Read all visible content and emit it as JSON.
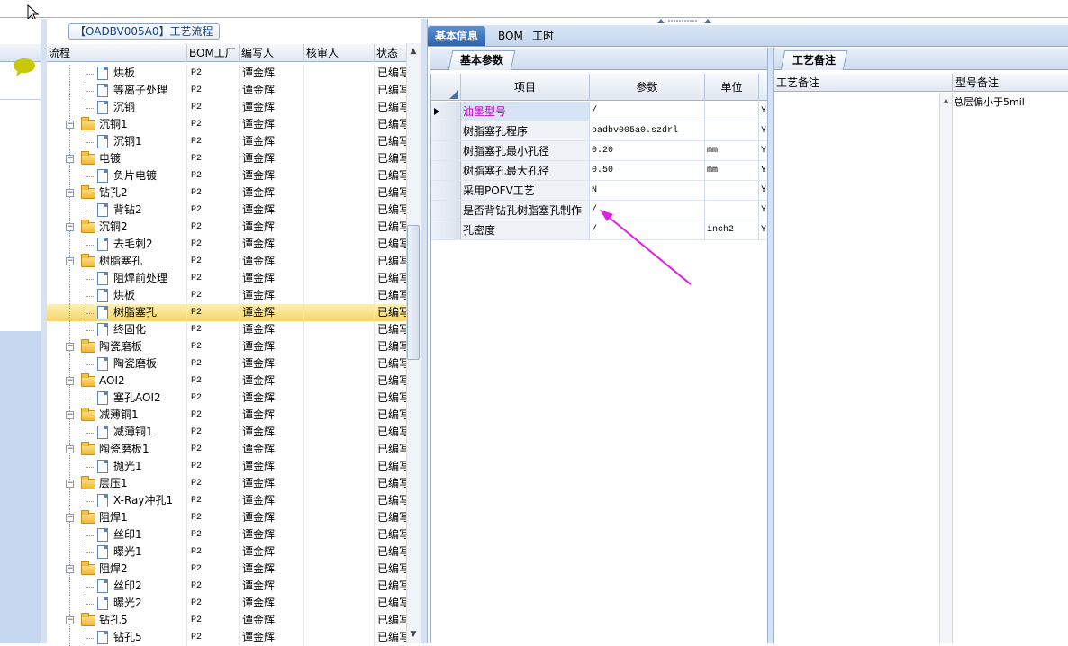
{
  "tree_panel": {
    "title": "【OADBV005A0】工艺流程",
    "columns": [
      "流程",
      "BOM工厂",
      "编写人",
      "核审人",
      "状态"
    ],
    "rows": [
      {
        "label": "烘板",
        "type": "doc",
        "level": 2,
        "bom": "P2",
        "author": "谭金辉",
        "reviewer": "",
        "status": "已编写"
      },
      {
        "label": "等离子处理",
        "type": "doc",
        "level": 2,
        "bom": "P2",
        "author": "谭金辉",
        "reviewer": "",
        "status": "已编写"
      },
      {
        "label": "沉铜",
        "type": "doc",
        "level": 2,
        "bom": "P2",
        "author": "谭金辉",
        "reviewer": "",
        "status": "已编写"
      },
      {
        "label": "沉铜1",
        "type": "folder",
        "level": 1,
        "bom": "P2",
        "author": "谭金辉",
        "reviewer": "",
        "status": "已编写"
      },
      {
        "label": "沉铜1",
        "type": "doc",
        "level": 2,
        "bom": "P2",
        "author": "谭金辉",
        "reviewer": "",
        "status": "已编写"
      },
      {
        "label": "电镀",
        "type": "folder",
        "level": 1,
        "bom": "P2",
        "author": "谭金辉",
        "reviewer": "",
        "status": "已编写"
      },
      {
        "label": "负片电镀",
        "type": "doc",
        "level": 2,
        "bom": "P2",
        "author": "谭金辉",
        "reviewer": "",
        "status": "已编写"
      },
      {
        "label": "钻孔2",
        "type": "folder",
        "level": 1,
        "bom": "P2",
        "author": "谭金辉",
        "reviewer": "",
        "status": "已编写"
      },
      {
        "label": "背钻2",
        "type": "doc",
        "level": 2,
        "bom": "P2",
        "author": "谭金辉",
        "reviewer": "",
        "status": "已编写"
      },
      {
        "label": "沉铜2",
        "type": "folder",
        "level": 1,
        "bom": "P2",
        "author": "谭金辉",
        "reviewer": "",
        "status": "已编写"
      },
      {
        "label": "去毛刺2",
        "type": "doc",
        "level": 2,
        "bom": "P2",
        "author": "谭金辉",
        "reviewer": "",
        "status": "已编写"
      },
      {
        "label": "树脂塞孔",
        "type": "folder",
        "level": 1,
        "bom": "P2",
        "author": "谭金辉",
        "reviewer": "",
        "status": "已编写"
      },
      {
        "label": "阻焊前处理",
        "type": "doc",
        "level": 2,
        "bom": "P2",
        "author": "谭金辉",
        "reviewer": "",
        "status": "已编写"
      },
      {
        "label": "烘板",
        "type": "doc",
        "level": 2,
        "bom": "P2",
        "author": "谭金辉",
        "reviewer": "",
        "status": "已编写"
      },
      {
        "label": "树脂塞孔",
        "type": "doc",
        "level": 2,
        "bom": "P2",
        "author": "谭金辉",
        "reviewer": "",
        "status": "已编写",
        "selected": true
      },
      {
        "label": "终固化",
        "type": "doc",
        "level": 2,
        "bom": "P2",
        "author": "谭金辉",
        "reviewer": "",
        "status": "已编写"
      },
      {
        "label": "陶瓷磨板",
        "type": "folder",
        "level": 1,
        "bom": "P2",
        "author": "谭金辉",
        "reviewer": "",
        "status": "已编写"
      },
      {
        "label": "陶瓷磨板",
        "type": "doc",
        "level": 2,
        "bom": "P2",
        "author": "谭金辉",
        "reviewer": "",
        "status": "已编写"
      },
      {
        "label": "AOI2",
        "type": "folder",
        "level": 1,
        "bom": "P2",
        "author": "谭金辉",
        "reviewer": "",
        "status": "已编写"
      },
      {
        "label": "塞孔AOI2",
        "type": "doc",
        "level": 2,
        "bom": "P2",
        "author": "谭金辉",
        "reviewer": "",
        "status": "已编写"
      },
      {
        "label": "减薄铜1",
        "type": "folder",
        "level": 1,
        "bom": "P2",
        "author": "谭金辉",
        "reviewer": "",
        "status": "已编写"
      },
      {
        "label": "减薄铜1",
        "type": "doc",
        "level": 2,
        "bom": "P2",
        "author": "谭金辉",
        "reviewer": "",
        "status": "已编写"
      },
      {
        "label": "陶瓷磨板1",
        "type": "folder",
        "level": 1,
        "bom": "P2",
        "author": "谭金辉",
        "reviewer": "",
        "status": "已编写"
      },
      {
        "label": "抛光1",
        "type": "doc",
        "level": 2,
        "bom": "P2",
        "author": "谭金辉",
        "reviewer": "",
        "status": "已编写"
      },
      {
        "label": "层压1",
        "type": "folder",
        "level": 1,
        "bom": "P2",
        "author": "谭金辉",
        "reviewer": "",
        "status": "已编写"
      },
      {
        "label": "X-Ray冲孔1",
        "type": "doc",
        "level": 2,
        "bom": "P2",
        "author": "谭金辉",
        "reviewer": "",
        "status": "已编写"
      },
      {
        "label": "阻焊1",
        "type": "folder",
        "level": 1,
        "bom": "P2",
        "author": "谭金辉",
        "reviewer": "",
        "status": "已编写"
      },
      {
        "label": "丝印1",
        "type": "doc",
        "level": 2,
        "bom": "P2",
        "author": "谭金辉",
        "reviewer": "",
        "status": "已编写"
      },
      {
        "label": "曝光1",
        "type": "doc",
        "level": 2,
        "bom": "P2",
        "author": "谭金辉",
        "reviewer": "",
        "status": "已编写"
      },
      {
        "label": "阻焊2",
        "type": "folder",
        "level": 1,
        "bom": "P2",
        "author": "谭金辉",
        "reviewer": "",
        "status": "已编写"
      },
      {
        "label": "丝印2",
        "type": "doc",
        "level": 2,
        "bom": "P2",
        "author": "谭金辉",
        "reviewer": "",
        "status": "已编写"
      },
      {
        "label": "曝光2",
        "type": "doc",
        "level": 2,
        "bom": "P2",
        "author": "谭金辉",
        "reviewer": "",
        "status": "已编写"
      },
      {
        "label": "钻孔5",
        "type": "folder",
        "level": 1,
        "bom": "P2",
        "author": "谭金辉",
        "reviewer": "",
        "status": "已编写"
      },
      {
        "label": "钻孔5",
        "type": "doc",
        "level": 2,
        "bom": "P2",
        "author": "谭金辉",
        "reviewer": "",
        "status": "已编写"
      }
    ]
  },
  "main_tabs": [
    "基本信息",
    "BOM",
    "工时"
  ],
  "params_panel": {
    "tab": "基本参数",
    "columns": [
      "项目",
      "参数",
      "单位"
    ],
    "rows": [
      {
        "item": "油墨型号",
        "param": "/",
        "unit": "",
        "flag": "Y",
        "current": true
      },
      {
        "item": "树脂塞孔程序",
        "param": "oadbv005a0.szdrl",
        "unit": "",
        "flag": "Y"
      },
      {
        "item": "树脂塞孔最小孔径",
        "param": "0.20",
        "unit": "mm",
        "flag": "Y"
      },
      {
        "item": "树脂塞孔最大孔径",
        "param": "0.50",
        "unit": "mm",
        "flag": "Y"
      },
      {
        "item": "采用POFV工艺",
        "param": "N",
        "unit": "",
        "flag": "Y"
      },
      {
        "item": "是否背钻孔树脂塞孔制作",
        "param": "/",
        "unit": "",
        "flag": "Y"
      },
      {
        "item": "孔密度",
        "param": "/",
        "unit": "inch2",
        "flag": "Y"
      }
    ]
  },
  "notes_panel": {
    "tab": "工艺备注",
    "columns": [
      "工艺备注",
      "型号备注"
    ],
    "model_note": "总层偏小于5mil"
  },
  "colors": {
    "accent": "#2f64ad",
    "highlight_text": "#c000c0",
    "arrow": "#e020e0",
    "selection": "#f8d46a"
  }
}
